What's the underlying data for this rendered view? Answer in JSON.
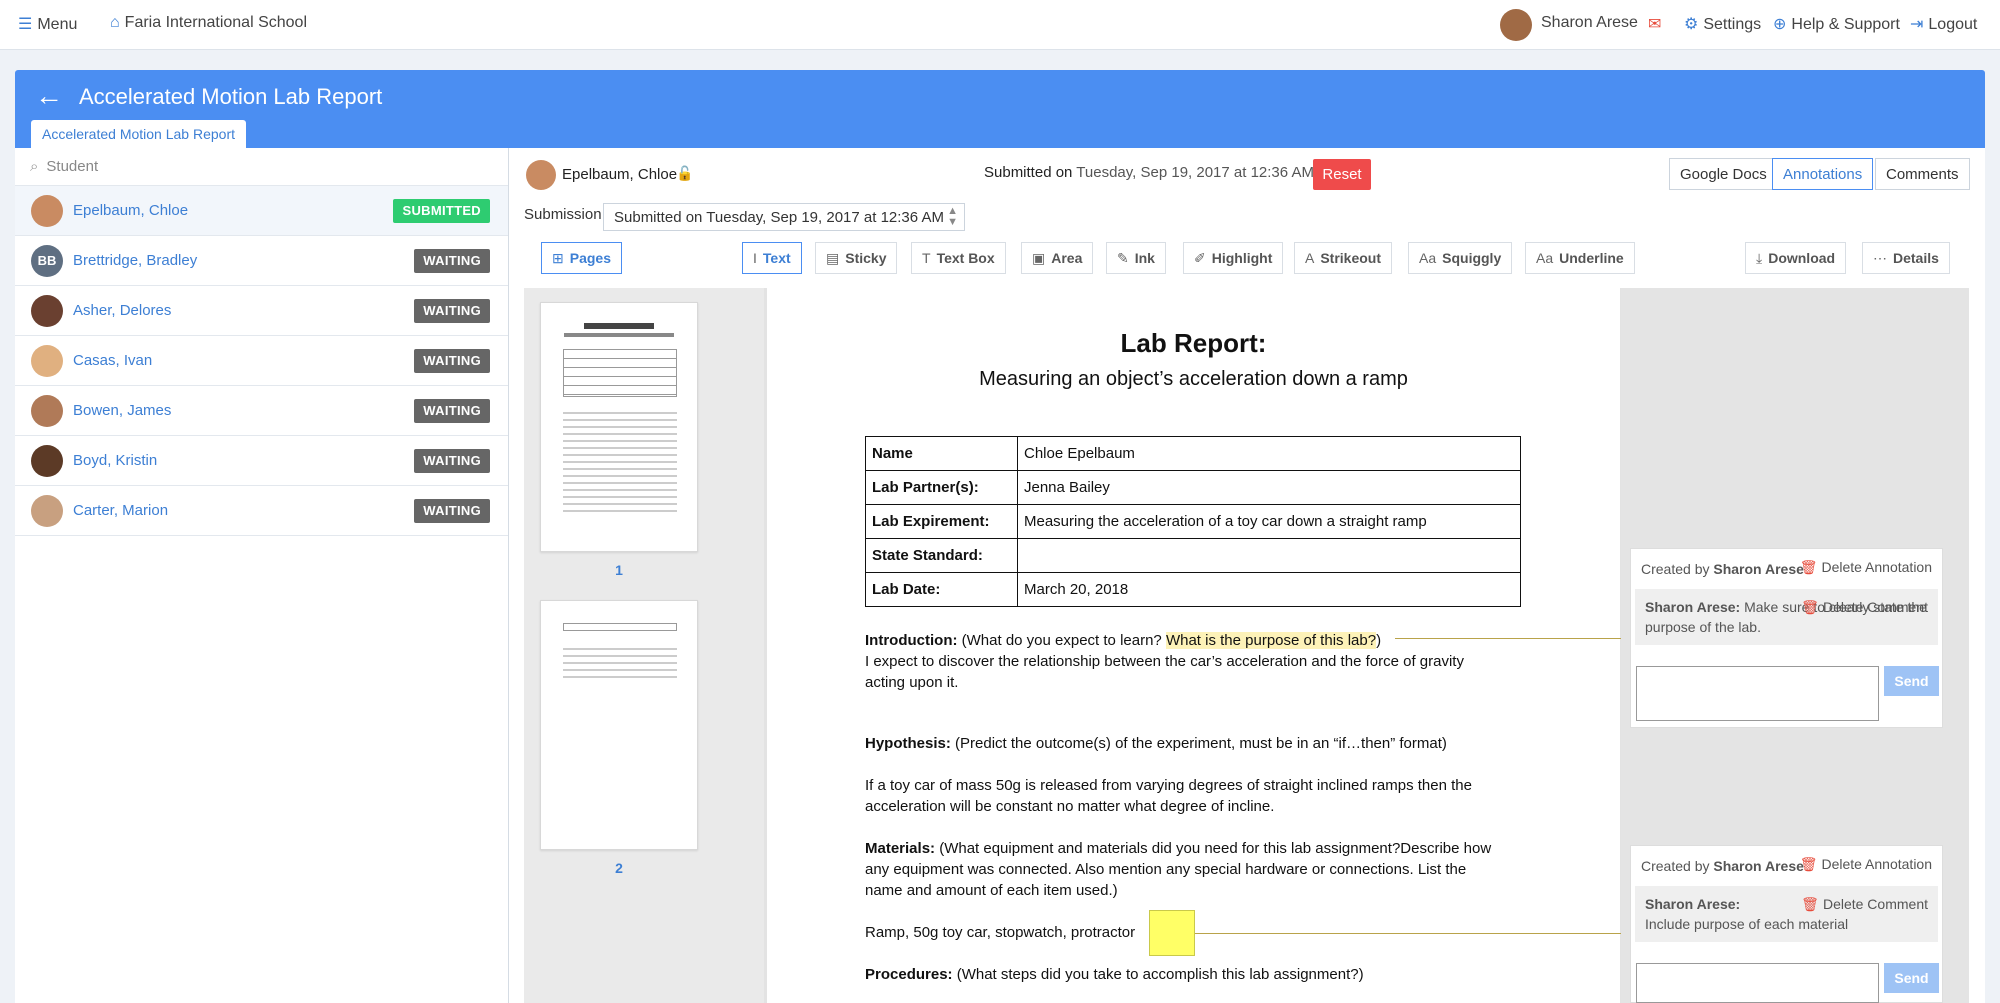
{
  "nav": {
    "menu": "Menu",
    "school": "Faria International School",
    "user": "Sharon Arese",
    "settings": "Settings",
    "help": "Help & Support",
    "logout": "Logout"
  },
  "header": {
    "title": "Accelerated Motion Lab Report",
    "tab": "Accelerated Motion Lab Report"
  },
  "search": {
    "placeholder": "Student"
  },
  "students": [
    {
      "name": "Epelbaum, Chloe",
      "status": "SUBMITTED",
      "initials": "",
      "color": "#c98b62"
    },
    {
      "name": "Brettridge, Bradley",
      "status": "WAITING",
      "initials": "BB",
      "color": "#5f6f82"
    },
    {
      "name": "Asher, Delores",
      "status": "WAITING",
      "initials": "",
      "color": "#6a4030"
    },
    {
      "name": "Casas, Ivan",
      "status": "WAITING",
      "initials": "",
      "color": "#e0b080"
    },
    {
      "name": "Bowen, James",
      "status": "WAITING",
      "initials": "",
      "color": "#b07a58"
    },
    {
      "name": "Boyd, Kristin",
      "status": "WAITING",
      "initials": "",
      "color": "#5c3a26"
    },
    {
      "name": "Carter, Marion",
      "status": "WAITING",
      "initials": "",
      "color": "#c8a080"
    }
  ],
  "submission_header": {
    "student": "Epelbaum, Chloe",
    "submitted_prefix": "Submitted on",
    "submitted_date": "Tuesday, Sep 19, 2017 at 12:36 AM",
    "reset": "Reset",
    "submission_label": "Submission",
    "submission_select": "Submitted on Tuesday, Sep 19, 2017 at 12:36 AM"
  },
  "view_tabs": [
    "Google Docs",
    "Annotations",
    "Comments"
  ],
  "toolbar": {
    "pages": "Pages",
    "tools": [
      {
        "label": "Text",
        "icon": "I"
      },
      {
        "label": "Sticky",
        "icon": "▤"
      },
      {
        "label": "Text Box",
        "icon": "T"
      },
      {
        "label": "Area",
        "icon": "▣"
      },
      {
        "label": "Ink",
        "icon": "✎"
      },
      {
        "label": "Highlight",
        "icon": "✐"
      },
      {
        "label": "Strikeout",
        "icon": "A"
      },
      {
        "label": "Squiggly",
        "icon": "Aa"
      },
      {
        "label": "Underline",
        "icon": "Aa"
      }
    ],
    "download": "Download",
    "details": "Details"
  },
  "thumbnails": [
    "1",
    "2"
  ],
  "document": {
    "title": "Lab Report:",
    "subtitle": "Measuring an object’s acceleration down a ramp",
    "table": [
      [
        "Name",
        "Chloe Epelbaum"
      ],
      [
        "Lab Partner(s):",
        "Jenna Bailey"
      ],
      [
        "Lab Expirement:",
        "Measuring the acceleration of a toy car down a straight ramp"
      ],
      [
        "State Standard:",
        ""
      ],
      [
        "Lab Date:",
        "March 20, 2018"
      ]
    ],
    "intro_label": "Introduction:",
    "intro_prompt": " (What do you expect to learn? ",
    "intro_highlight": "What is the purpose of this lab?",
    "intro_close": ")",
    "intro_answer_1": "I expect to discover the relationship between the car’s acceleration and the force of gravity",
    "intro_answer_2": "acting upon it.",
    "hyp_label": "Hypothesis:",
    "hyp_prompt": " (Predict the outcome(s) of the experiment, must be in an “if…then” format)",
    "hyp_answer_1": "If a toy car of mass 50g is released from varying degrees of straight inclined ramps then the",
    "hyp_answer_2": "acceleration will be constant no matter what degree of incline.",
    "mat_label": "Materials:",
    "mat_prompt_1": " (What equipment and materials did you need for this lab assignment?Describe how",
    "mat_prompt_2": "any equipment was connected. Also mention any special hardware or connections. List the",
    "mat_prompt_3": "name and amount of each item used.)",
    "mat_answer": "Ramp, 50g toy car, stopwatch, protractor",
    "proc_label": "Procedures:",
    "proc_prompt": " (What steps did you take to accomplish this lab assignment?)"
  },
  "annotations": [
    {
      "created_prefix": "Created by ",
      "created_by": "Sharon Arese",
      "delete_annotation": "Delete Annotation",
      "comment_author": "Sharon Arese:",
      "comment_text": " Make sure to clearly state the purpose of the lab.",
      "delete_comment": "Delete Comment",
      "send": "Send"
    },
    {
      "created_prefix": "Created by ",
      "created_by": "Sharon Arese",
      "delete_annotation": "Delete Annotation",
      "comment_author": "Sharon Arese:",
      "comment_text": "Include purpose of each material",
      "delete_comment": "Delete Comment",
      "send": "Send"
    }
  ],
  "colors": {
    "brand_blue": "#4b8ef2",
    "submitted_green": "#2ecc71",
    "waiting_gray": "#666666",
    "reset_red": "#ef4b4b",
    "highlight_yellow": "#fdf2b8",
    "sticky_yellow": "#ffff66"
  }
}
